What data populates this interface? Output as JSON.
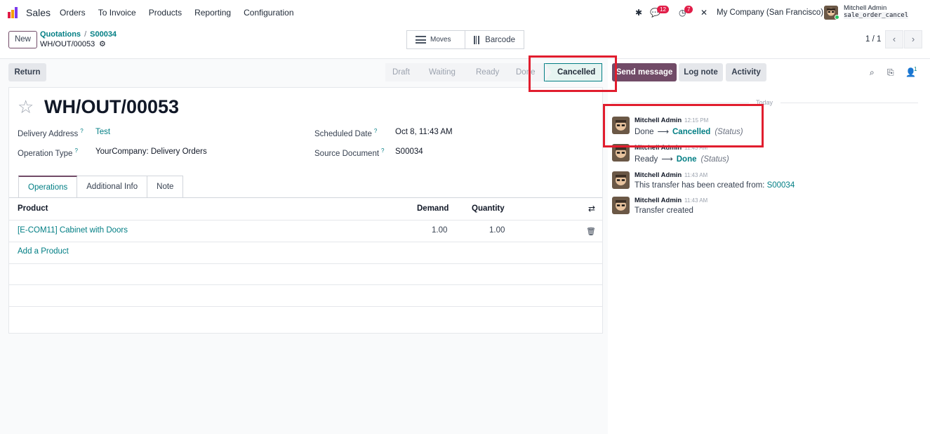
{
  "navbar": {
    "app_name": "Sales",
    "menu": [
      "Orders",
      "To Invoice",
      "Products",
      "Reporting",
      "Configuration"
    ],
    "messages_badge": "12",
    "activities_badge": "7",
    "company": "My Company (San Francisco)",
    "user_name": "Mitchell Admin",
    "db_name": "sale_order_cancel"
  },
  "control_panel": {
    "new_label": "New",
    "breadcrumb": [
      "Quotations",
      "S00034"
    ],
    "breadcrumb_sep": "/",
    "record_name": "WH/OUT/00053",
    "smart_buttons": {
      "moves": "Moves",
      "barcode": "Barcode"
    },
    "pager": "1 / 1"
  },
  "statusbar": {
    "return_label": "Return",
    "steps": [
      "Draft",
      "Waiting",
      "Ready",
      "Done"
    ],
    "current": "Cancelled"
  },
  "chatter_buttons": {
    "send_message": "Send message",
    "log_note": "Log note",
    "activity": "Activity",
    "followers_count": "1"
  },
  "form": {
    "title": "WH/OUT/00053",
    "fields": {
      "delivery_address_label": "Delivery Address",
      "delivery_address": "Test",
      "operation_type_label": "Operation Type",
      "operation_type": "YourCompany: Delivery Orders",
      "scheduled_date_label": "Scheduled Date",
      "scheduled_date": "Oct 8, 11:43 AM",
      "source_document_label": "Source Document",
      "source_document": "S00034",
      "help_mark": "?"
    },
    "tabs": [
      "Operations",
      "Additional Info",
      "Note"
    ],
    "table": {
      "headers": {
        "product": "Product",
        "demand": "Demand",
        "quantity": "Quantity"
      },
      "rows": [
        {
          "product": "[E-COM11] Cabinet with Doors",
          "demand": "1.00",
          "quantity": "1.00"
        }
      ],
      "add_product": "Add a Product"
    }
  },
  "chatter": {
    "date_separator": "Today",
    "messages": [
      {
        "author": "Mitchell Admin",
        "time": "12:15 PM",
        "from": "Done",
        "to": "Cancelled",
        "field": "(Status)"
      },
      {
        "author": "Mitchell Admin",
        "time": "11:43 AM",
        "from": "Ready",
        "to": "Done",
        "field": "(Status)"
      },
      {
        "author": "Mitchell Admin",
        "time": "11:43 AM",
        "text": "This transfer has been created from:",
        "link": "S00034"
      },
      {
        "author": "Mitchell Admin",
        "time": "11:43 AM",
        "text": "Transfer created"
      }
    ]
  },
  "colors": {
    "brand": "#714b67",
    "link": "#017e84",
    "highlight": "#e11d2e"
  }
}
